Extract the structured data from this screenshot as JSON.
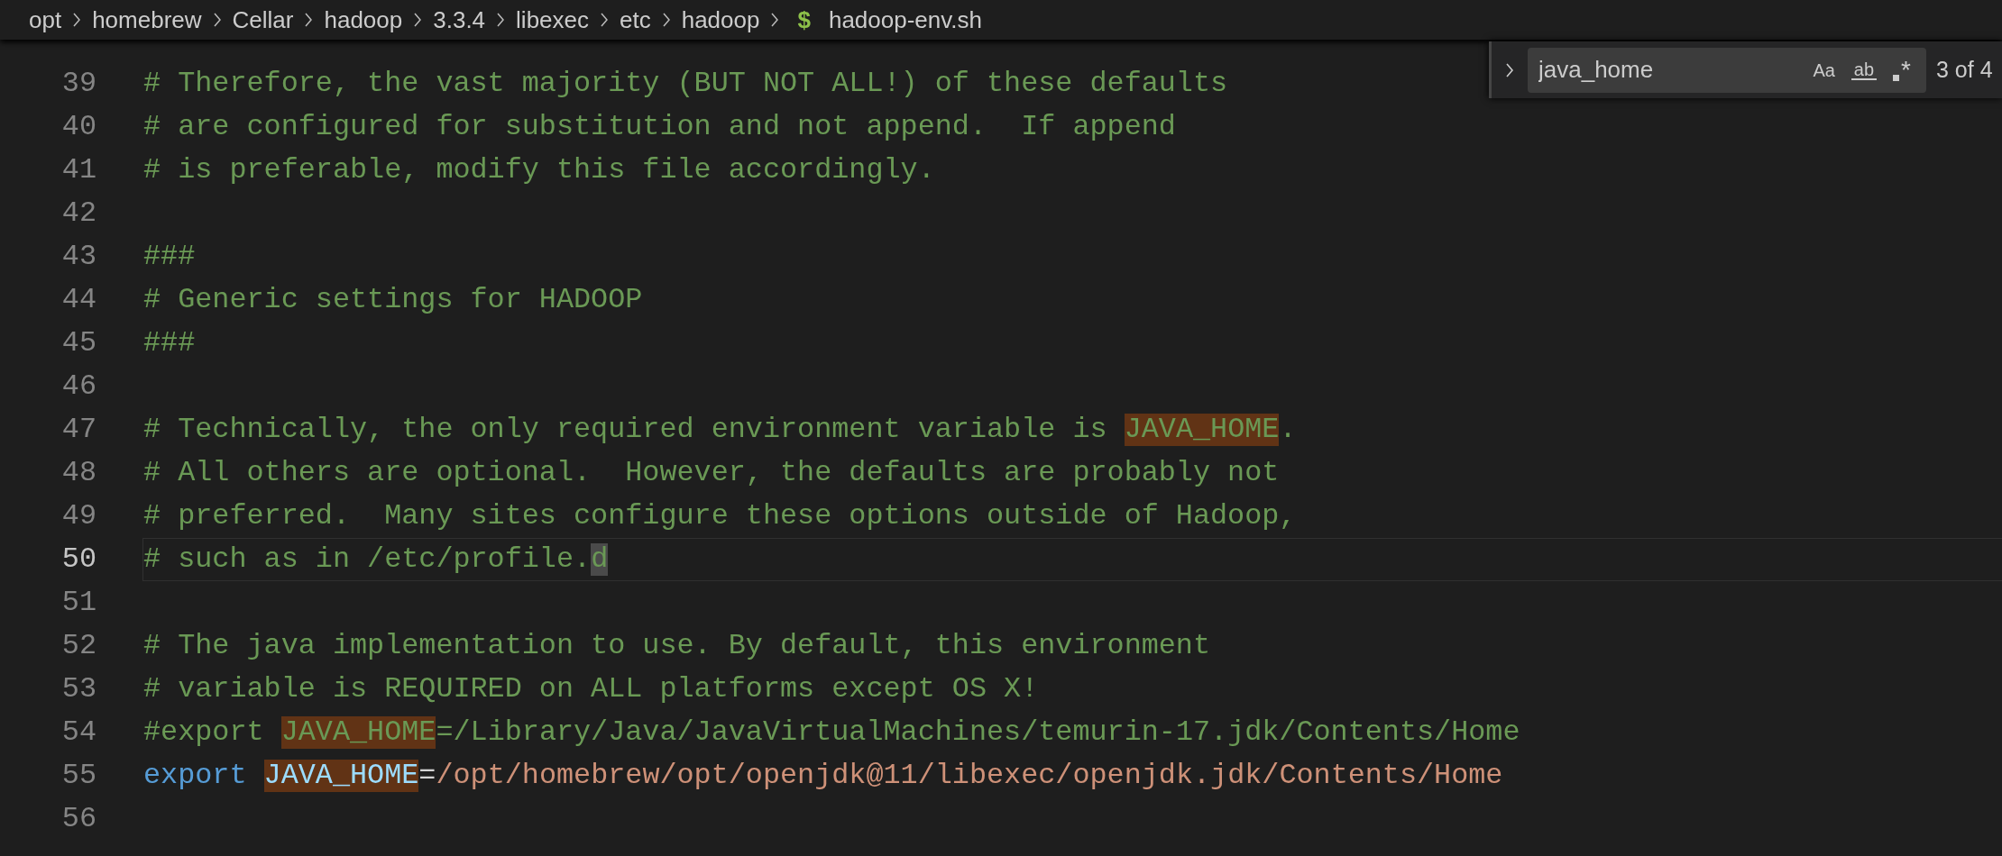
{
  "breadcrumb": {
    "items": [
      {
        "kind": "folder",
        "label": "opt"
      },
      {
        "kind": "folder",
        "label": "homebrew"
      },
      {
        "kind": "folder",
        "label": "Cellar"
      },
      {
        "kind": "folder",
        "label": "hadoop"
      },
      {
        "kind": "folder",
        "label": "3.3.4"
      },
      {
        "kind": "folder",
        "label": "libexec"
      },
      {
        "kind": "folder",
        "label": "etc"
      },
      {
        "kind": "folder",
        "label": "hadoop"
      },
      {
        "kind": "file",
        "icon": "$",
        "label": "hadoop-env.sh"
      }
    ]
  },
  "editor": {
    "lines": [
      {
        "number": "39",
        "current": false,
        "segments": [
          {
            "kind": "comment",
            "text": "# Therefore, the vast majority (BUT NOT ALL!) of these defaults",
            "match": false,
            "cursor": false
          }
        ]
      },
      {
        "number": "40",
        "current": false,
        "segments": [
          {
            "kind": "comment",
            "text": "# are configured for substitution and not append.  If append",
            "match": false,
            "cursor": false
          }
        ]
      },
      {
        "number": "41",
        "current": false,
        "segments": [
          {
            "kind": "comment",
            "text": "# is preferable, modify this file accordingly.",
            "match": false,
            "cursor": false
          }
        ]
      },
      {
        "number": "42",
        "current": false
      },
      {
        "number": "43",
        "current": false,
        "segments": [
          {
            "kind": "comment",
            "text": "###",
            "match": false,
            "cursor": false
          }
        ]
      },
      {
        "number": "44",
        "current": false,
        "segments": [
          {
            "kind": "comment",
            "text": "# Generic settings for HADOOP",
            "match": false,
            "cursor": false
          }
        ]
      },
      {
        "number": "45",
        "current": false,
        "segments": [
          {
            "kind": "comment",
            "text": "###",
            "match": false,
            "cursor": false
          }
        ]
      },
      {
        "number": "46",
        "current": false
      },
      {
        "number": "47",
        "current": false,
        "segments": [
          {
            "kind": "comment",
            "text": "# Technically, the only required environment variable is ",
            "match": false,
            "cursor": false
          },
          {
            "kind": "comment",
            "text": "JAVA_HOME",
            "match": true,
            "cursor": false
          },
          {
            "kind": "comment",
            "text": ".",
            "match": false,
            "cursor": false
          }
        ]
      },
      {
        "number": "48",
        "current": false,
        "segments": [
          {
            "kind": "comment",
            "text": "# All others are optional.  However, the defaults are probably not",
            "match": false,
            "cursor": false
          }
        ]
      },
      {
        "number": "49",
        "current": false,
        "segments": [
          {
            "kind": "comment",
            "text": "# preferred.  Many sites configure these options outside of Hadoop,",
            "match": false,
            "cursor": false
          }
        ]
      },
      {
        "number": "50",
        "current": true,
        "segments": [
          {
            "kind": "comment",
            "text": "# such as in /etc/profile.",
            "match": false,
            "cursor": false
          },
          {
            "kind": "comment",
            "text": "d",
            "match": false,
            "cursor": true
          }
        ]
      },
      {
        "number": "51",
        "current": false
      },
      {
        "number": "52",
        "current": false,
        "segments": [
          {
            "kind": "comment",
            "text": "# The java implementation to use. By default, this environment",
            "match": false,
            "cursor": false
          }
        ]
      },
      {
        "number": "53",
        "current": false,
        "segments": [
          {
            "kind": "comment",
            "text": "# variable is REQUIRED on ALL platforms except OS X!",
            "match": false,
            "cursor": false
          }
        ]
      },
      {
        "number": "54",
        "current": false,
        "segments": [
          {
            "kind": "comment",
            "text": "#export ",
            "match": false,
            "cursor": false
          },
          {
            "kind": "comment",
            "text": "JAVA_HOME",
            "match": true,
            "cursor": false
          },
          {
            "kind": "comment",
            "text": "=/Library/Java/JavaVirtualMachines/temurin-17.jdk/Contents/Home",
            "match": false,
            "cursor": false
          }
        ]
      },
      {
        "number": "55",
        "current": false,
        "segments": [
          {
            "kind": "keyword",
            "text": "export ",
            "match": false,
            "cursor": false
          },
          {
            "kind": "variable",
            "text": "JAVA_HOME",
            "match": true,
            "cursor": false
          },
          {
            "kind": "plain",
            "text": "=",
            "match": false,
            "cursor": false
          },
          {
            "kind": "string",
            "text": "/opt/homebrew/opt/openjdk@11/libexec/openjdk.jdk/Contents/Home",
            "match": false,
            "cursor": false
          }
        ]
      },
      {
        "number": "56",
        "current": false
      }
    ]
  },
  "find_widget": {
    "expanded": false,
    "query": "java_home",
    "options": [
      {
        "kind": "case",
        "label": "Aa",
        "on": false
      },
      {
        "kind": "word",
        "label": "ab",
        "on": false
      },
      {
        "kind": "regex",
        "label": "*",
        "on": false
      }
    ],
    "match_count": "3 of 4"
  }
}
